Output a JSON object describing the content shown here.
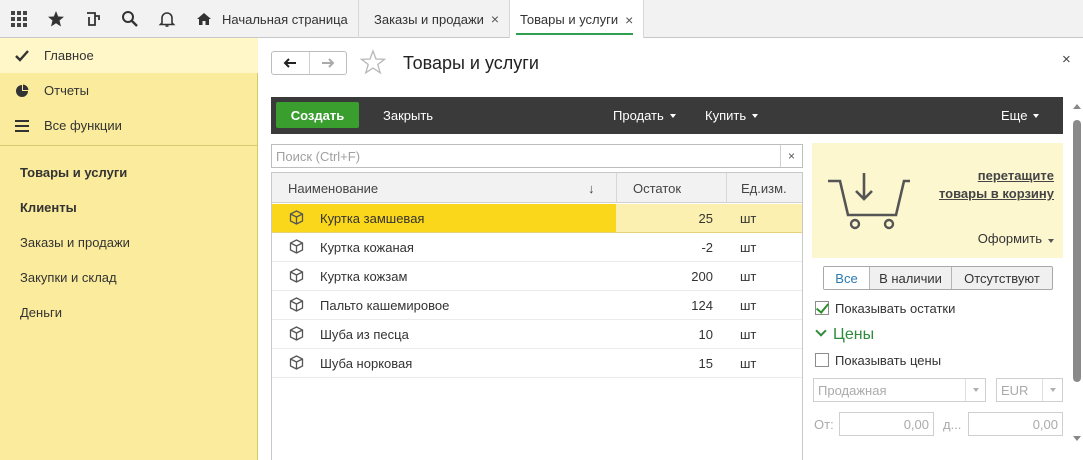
{
  "topbar": {
    "tabs": [
      {
        "label": "Начальная страница"
      },
      {
        "label": "Заказы и продажи",
        "close": "×"
      },
      {
        "label": "Товары и услуги",
        "close": "×"
      }
    ]
  },
  "sidebar": {
    "items": [
      {
        "label": "Главное"
      },
      {
        "label": "Отчеты"
      },
      {
        "label": "Все функции"
      }
    ],
    "links": [
      {
        "label": "Товары и услуги"
      },
      {
        "label": "Клиенты"
      },
      {
        "label": "Заказы и продажи"
      },
      {
        "label": "Закупки и склад"
      },
      {
        "label": "Деньги"
      }
    ]
  },
  "page": {
    "title": "Товары и услуги",
    "close": "×"
  },
  "commandbar": {
    "create": "Создать",
    "close": "Закрыть",
    "sell": "Продать",
    "buy": "Купить",
    "more": "Еще"
  },
  "search": {
    "placeholder": "Поиск (Ctrl+F)",
    "clear": "×"
  },
  "table": {
    "columns": {
      "name": "Наименование",
      "sort": "↓",
      "qty": "Остаток",
      "unit": "Ед.изм."
    },
    "rows": [
      {
        "name": "Куртка замшевая",
        "qty": "25",
        "unit": "шт"
      },
      {
        "name": "Куртка кожаная",
        "qty": "-2",
        "unit": "шт"
      },
      {
        "name": "Куртка кожзам",
        "qty": "200",
        "unit": "шт"
      },
      {
        "name": "Пальто кашемировое",
        "qty": "124",
        "unit": "шт"
      },
      {
        "name": "Шуба из песца",
        "qty": "10",
        "unit": "шт"
      },
      {
        "name": "Шуба норковая",
        "qty": "15",
        "unit": "шт"
      }
    ]
  },
  "cart": {
    "hint_line1": "перетащите",
    "hint_line2": "товары в корзину",
    "order": "Оформить"
  },
  "filter": {
    "all": "Все",
    "in_stock": "В наличии",
    "absent": "Отсутствуют"
  },
  "options": {
    "show_stock": "Показывать остатки",
    "show_stock_checked": true,
    "prices_header": "Цены",
    "show_prices": "Показывать цены",
    "show_prices_checked": false,
    "price_type": "Продажная",
    "currency": "EUR",
    "from_label": "От:",
    "from_value": "0,00",
    "to_label": "д...",
    "to_value": "0,00"
  },
  "colors": {
    "sidebar_bg": "#fbec9d",
    "selected_row": "#fad71a",
    "create_button": "#3a9e2f",
    "command_bar": "#3a3a3a",
    "accent_green": "#2f8c3c"
  }
}
